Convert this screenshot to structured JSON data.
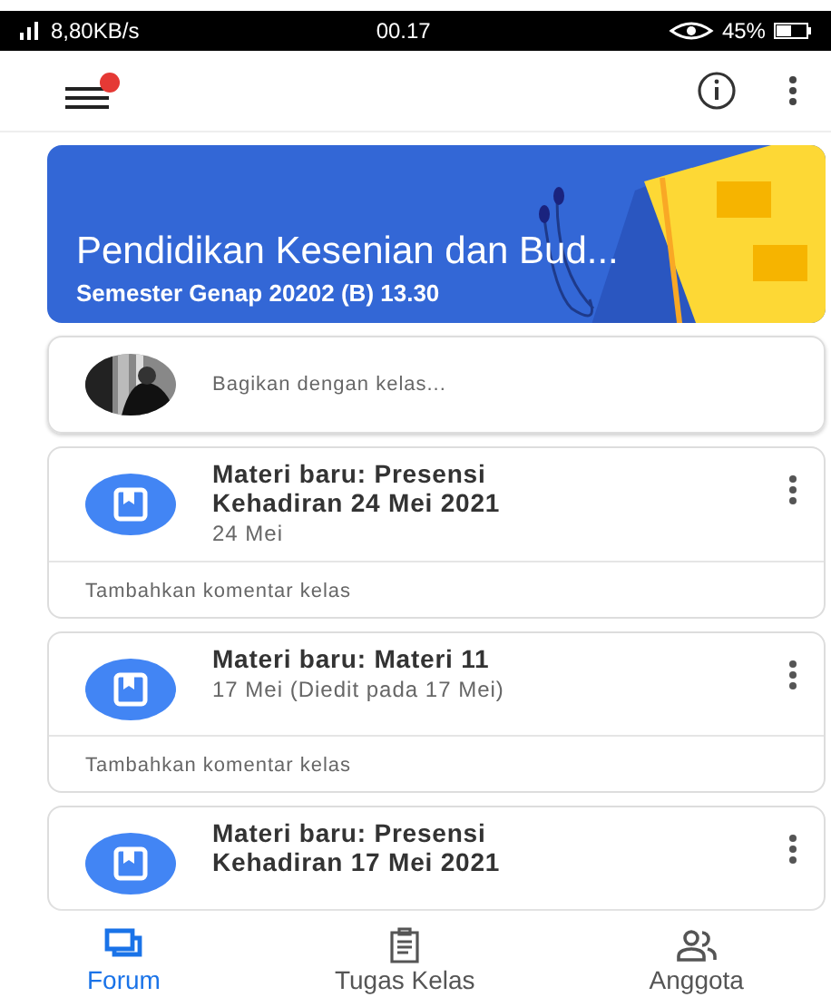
{
  "status_bar": {
    "network": "8,80KB/s",
    "time": "00.17",
    "battery": "45%"
  },
  "app_bar": {
    "notification_dot": true
  },
  "banner": {
    "title": "Pendidikan Kesenian dan Bud...",
    "subtitle": "Semester Genap 20202 (B) 13.30"
  },
  "share": {
    "placeholder": "Bagikan dengan kelas..."
  },
  "posts": [
    {
      "title": "Materi baru: Presensi Kehadiran 24 Mei 2021",
      "date": "24 Mei",
      "comment_placeholder": "Tambahkan komentar kelas"
    },
    {
      "title": "Materi baru: Materi 11",
      "date": "17 Mei (Diedit pada 17 Mei)",
      "comment_placeholder": "Tambahkan komentar kelas"
    },
    {
      "title": "Materi baru: Presensi Kehadiran 17 Mei 2021"
    }
  ],
  "bottom_nav": [
    {
      "label": "Forum",
      "kind": "forum",
      "selected": true
    },
    {
      "label": "Tugas Kelas",
      "kind": "tasks",
      "selected": false
    },
    {
      "label": "Anggota",
      "kind": "people",
      "selected": false
    }
  ]
}
